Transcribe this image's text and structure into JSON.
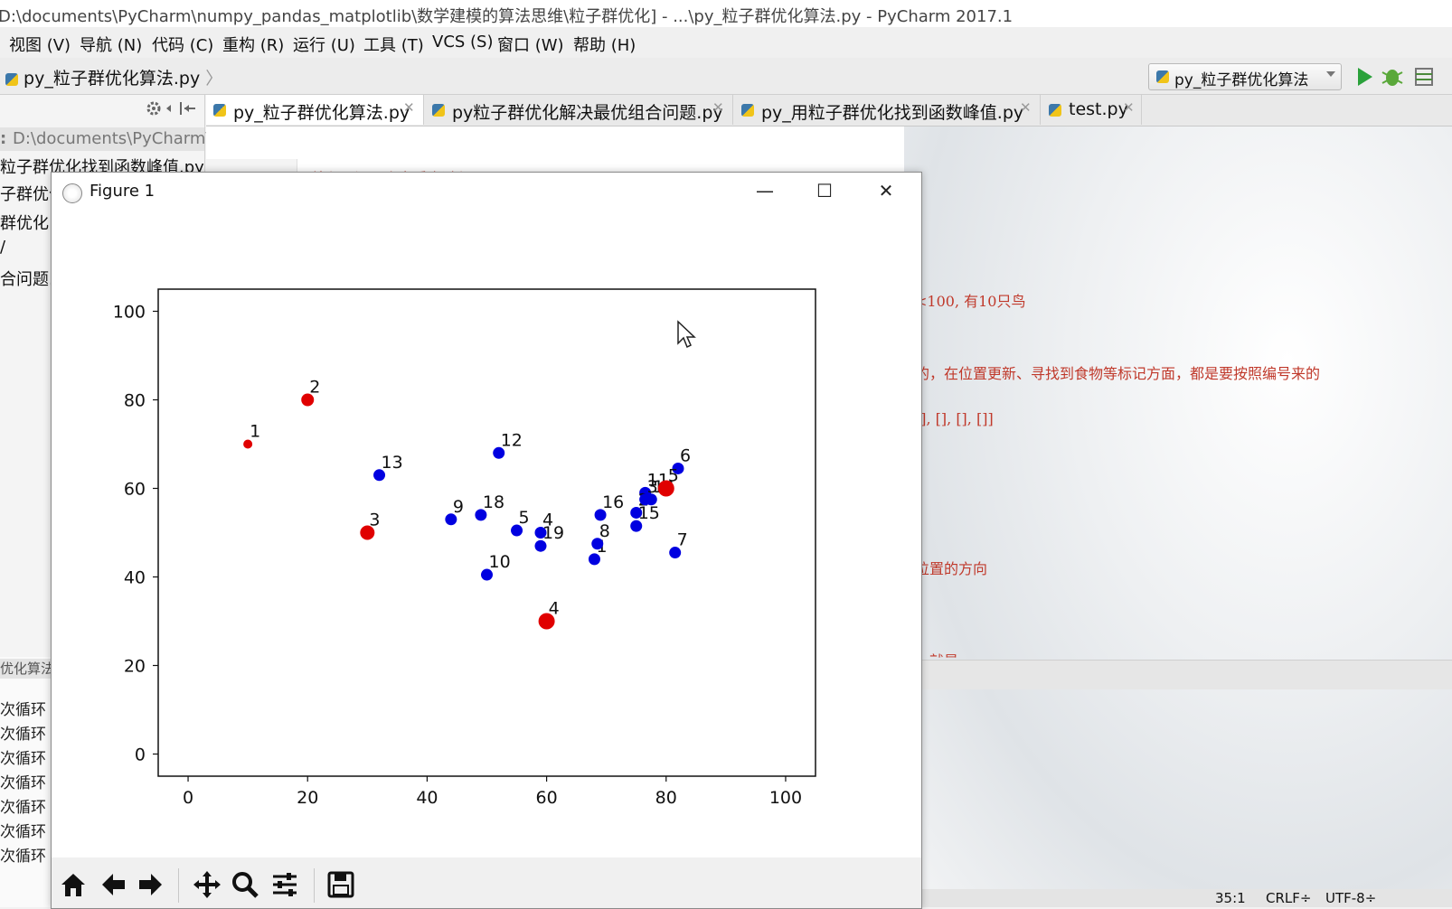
{
  "window": {
    "title": "D:\\documents\\PyCharm\\numpy_pandas_matplotlib\\数学建模的算法思维\\粒子群优化] - ...\\py_粒子群优化算法.py - PyCharm 2017.1"
  },
  "menu": {
    "items": [
      "视图 (V)",
      "导航 (N)",
      "代码 (C)",
      "重构 (R)",
      "运行 (U)",
      "工具 (T)",
      "VCS (S)",
      "窗口 (W)",
      "帮助 (H)"
    ]
  },
  "nav": {
    "breadcrumb": "py_粒子群优化算法.py",
    "run_config": "py_粒子群优化算法"
  },
  "project": {
    "root": "D:\\documents\\PyCharm\\",
    "files": [
      "粒子群优化找到函数峰值.py",
      "子群优化",
      "群优化",
      "/",
      "合问题."
    ]
  },
  "tabs": [
    {
      "label": "py_粒子群优化算法.py",
      "active": true
    },
    {
      "label": "py粒子群优化解决最优组合问题.py",
      "active": false
    },
    {
      "label": "py_用粒子群优化找到函数峰值.py",
      "active": false
    },
    {
      "label": "test.py",
      "active": false
    }
  ],
  "editor": {
    "lines": [
      "# 编程：还原小鸟觅食过程",
      "<100, 有10只鸟",
      "的，在位置更新、寻找到食物等标记方面，都是要按照编号来的",
      "[], [], [], []]",
      "位置的方向",
      "，就是…"
    ]
  },
  "console": {
    "header": "优化算法",
    "lines": [
      "次循环",
      "次循环",
      "次循环",
      "次循环",
      "次循环",
      "次循环",
      "次循环"
    ]
  },
  "status": {
    "position": "35:1",
    "line_sep": "CRLF÷",
    "encoding": "UTF-8÷"
  },
  "figure": {
    "title": "Figure 1",
    "buttons": {
      "minimize": "—",
      "maximize": "☐",
      "close": "✕"
    },
    "toolbar": [
      "home-icon",
      "back-icon",
      "forward-icon",
      "pan-icon",
      "zoom-icon",
      "configure-icon",
      "save-icon"
    ]
  },
  "chart_data": {
    "type": "scatter",
    "title": "",
    "xlabel": "",
    "ylabel": "",
    "xlim": [
      -5,
      105
    ],
    "ylim": [
      -5,
      105
    ],
    "xticks": [
      0,
      20,
      40,
      60,
      80,
      100
    ],
    "yticks": [
      0,
      20,
      40,
      60,
      80,
      100
    ],
    "grid": false,
    "series": [
      {
        "color": "#e00000",
        "points": [
          {
            "x": 10,
            "y": 70,
            "label": "1",
            "size": 5
          },
          {
            "x": 20,
            "y": 80,
            "label": "2",
            "size": 7
          },
          {
            "x": 30,
            "y": 50,
            "label": "3",
            "size": 8
          },
          {
            "x": 60,
            "y": 30,
            "label": "4",
            "size": 9
          },
          {
            "x": 80,
            "y": 60,
            "label": "5",
            "size": 9
          }
        ]
      },
      {
        "color": "#0000e0",
        "points": [
          {
            "x": 68,
            "y": 44,
            "label": "1"
          },
          {
            "x": 59,
            "y": 50,
            "label": "4"
          },
          {
            "x": 55,
            "y": 50.5,
            "label": "5"
          },
          {
            "x": 82,
            "y": 64.5,
            "label": "6"
          },
          {
            "x": 81.5,
            "y": 45.5,
            "label": "7"
          },
          {
            "x": 68.5,
            "y": 47.5,
            "label": "8"
          },
          {
            "x": 44,
            "y": 53,
            "label": "9"
          },
          {
            "x": 50,
            "y": 40.5,
            "label": "10"
          },
          {
            "x": 76.5,
            "y": 59,
            "label": "11"
          },
          {
            "x": 52,
            "y": 68,
            "label": "12"
          },
          {
            "x": 32,
            "y": 63,
            "label": "13"
          },
          {
            "x": 77.5,
            "y": 57.5,
            "label": "14"
          },
          {
            "x": 75,
            "y": 51.5,
            "label": "15"
          },
          {
            "x": 69,
            "y": 54,
            "label": "16"
          },
          {
            "x": 49,
            "y": 54,
            "label": "18"
          },
          {
            "x": 59,
            "y": 47,
            "label": "19"
          },
          {
            "x": 75,
            "y": 54.5,
            "label": "2"
          },
          {
            "x": 76.5,
            "y": 57.5,
            "label": "3"
          }
        ]
      }
    ]
  }
}
